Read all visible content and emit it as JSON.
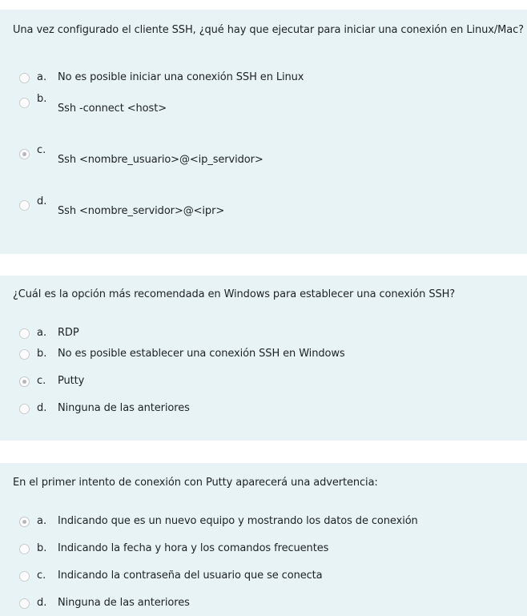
{
  "questions": [
    {
      "text": "Una vez configurado el cliente SSH, ¿qué hay que ejecutar para iniciar una conexión en Linux/Mac?",
      "options": [
        {
          "letter": "a.",
          "text": "No es posible iniciar una conexión SSH en Linux",
          "selected": false
        },
        {
          "letter": "b.",
          "text": "Ssh -connect <host>",
          "selected": false
        },
        {
          "letter": "c.",
          "text": "Ssh <nombre_usuario>@<ip_servidor>",
          "selected": true
        },
        {
          "letter": "d.",
          "text": "Ssh <nombre_servidor>@<ipr>",
          "selected": false
        }
      ]
    },
    {
      "text": "¿Cuál es la opción más recomendada en Windows para establecer una conexión SSH?",
      "options": [
        {
          "letter": "a.",
          "text": "RDP",
          "selected": false
        },
        {
          "letter": "b.",
          "text": "No es posible establecer una conexión SSH en Windows",
          "selected": false
        },
        {
          "letter": "c.",
          "text": "Putty",
          "selected": true
        },
        {
          "letter": "d.",
          "text": "Ninguna de las anteriores",
          "selected": false
        }
      ]
    },
    {
      "text": "En el primer intento de conexión con Putty aparecerá una advertencia:",
      "options": [
        {
          "letter": "a.",
          "text": "Indicando que es un nuevo equipo y mostrando los datos de conexión",
          "selected": true
        },
        {
          "letter": "b.",
          "text": "Indicando la fecha y hora y los comandos frecuentes",
          "selected": false
        },
        {
          "letter": "c.",
          "text": "Indicando la contraseña del usuario que se conecta",
          "selected": false
        },
        {
          "letter": "d.",
          "text": "Ninguna de las anteriores",
          "selected": false
        }
      ]
    }
  ],
  "colors": {
    "card_background": "#e7f3f5",
    "text": "#1d2125",
    "radio_border": "#c9cdd1",
    "radio_checked_dot": "#b4b8bd"
  }
}
